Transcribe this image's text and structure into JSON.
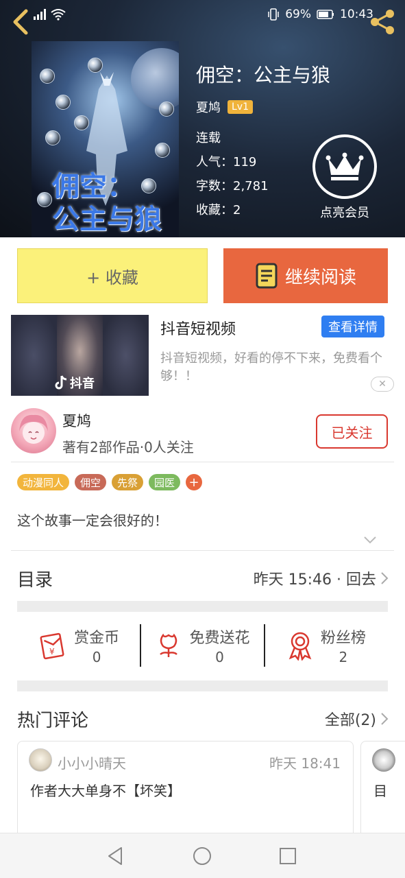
{
  "status": {
    "battery": "69%",
    "time": "10:43"
  },
  "book": {
    "title": "佣空：公主与狼",
    "cover_title_line1": "佣空：",
    "cover_title_line2": "公主与狼",
    "author": "夏鸠",
    "level": "Lv1",
    "status": "连载",
    "popularity_label": "人气：",
    "popularity": "119",
    "words_label": "字数：",
    "words": "2,781",
    "favorites_label": "收藏：",
    "favorites": "2",
    "vip_label": "点亮会员"
  },
  "actions": {
    "collect": "+ 收藏",
    "read": "继续阅读"
  },
  "ad": {
    "title": "抖音短视频",
    "button": "查看详情",
    "desc": "抖音短视频，好看的停不下来，免费看个够！！",
    "brand": "抖音",
    "close": "✕"
  },
  "author_info": {
    "name": "夏鸠",
    "stats": "著有2部作品·0人关注",
    "follow": "已关注"
  },
  "tags": [
    {
      "label": "动漫同人",
      "color": "#f2b53c"
    },
    {
      "label": "佣空",
      "color": "#c86a58"
    },
    {
      "label": "先祭",
      "color": "#d9a035"
    },
    {
      "label": "园医",
      "color": "#7dba5e"
    }
  ],
  "tag_add": "+",
  "intro": "这个故事一定会很好的！",
  "toc": {
    "title": "目录",
    "meta": "昨天 15:46 · 回去"
  },
  "stats": [
    {
      "label": "赏金币",
      "value": "0",
      "icon": "red-envelope-icon"
    },
    {
      "label": "免费送花",
      "value": "0",
      "icon": "flower-icon"
    },
    {
      "label": "粉丝榜",
      "value": "2",
      "icon": "ribbon-icon"
    }
  ],
  "comments": {
    "title": "热门评论",
    "all": "全部(2)",
    "items": [
      {
        "user": "小小小晴天",
        "time": "昨天 18:41",
        "content": "作者大大单身不【坏笑】"
      },
      {
        "content": "目"
      }
    ]
  },
  "colors": {
    "accent": "#e8673f",
    "follow": "#d9382f",
    "collect_bg": "#fbf17a",
    "ad_button": "#2f7ef1"
  }
}
